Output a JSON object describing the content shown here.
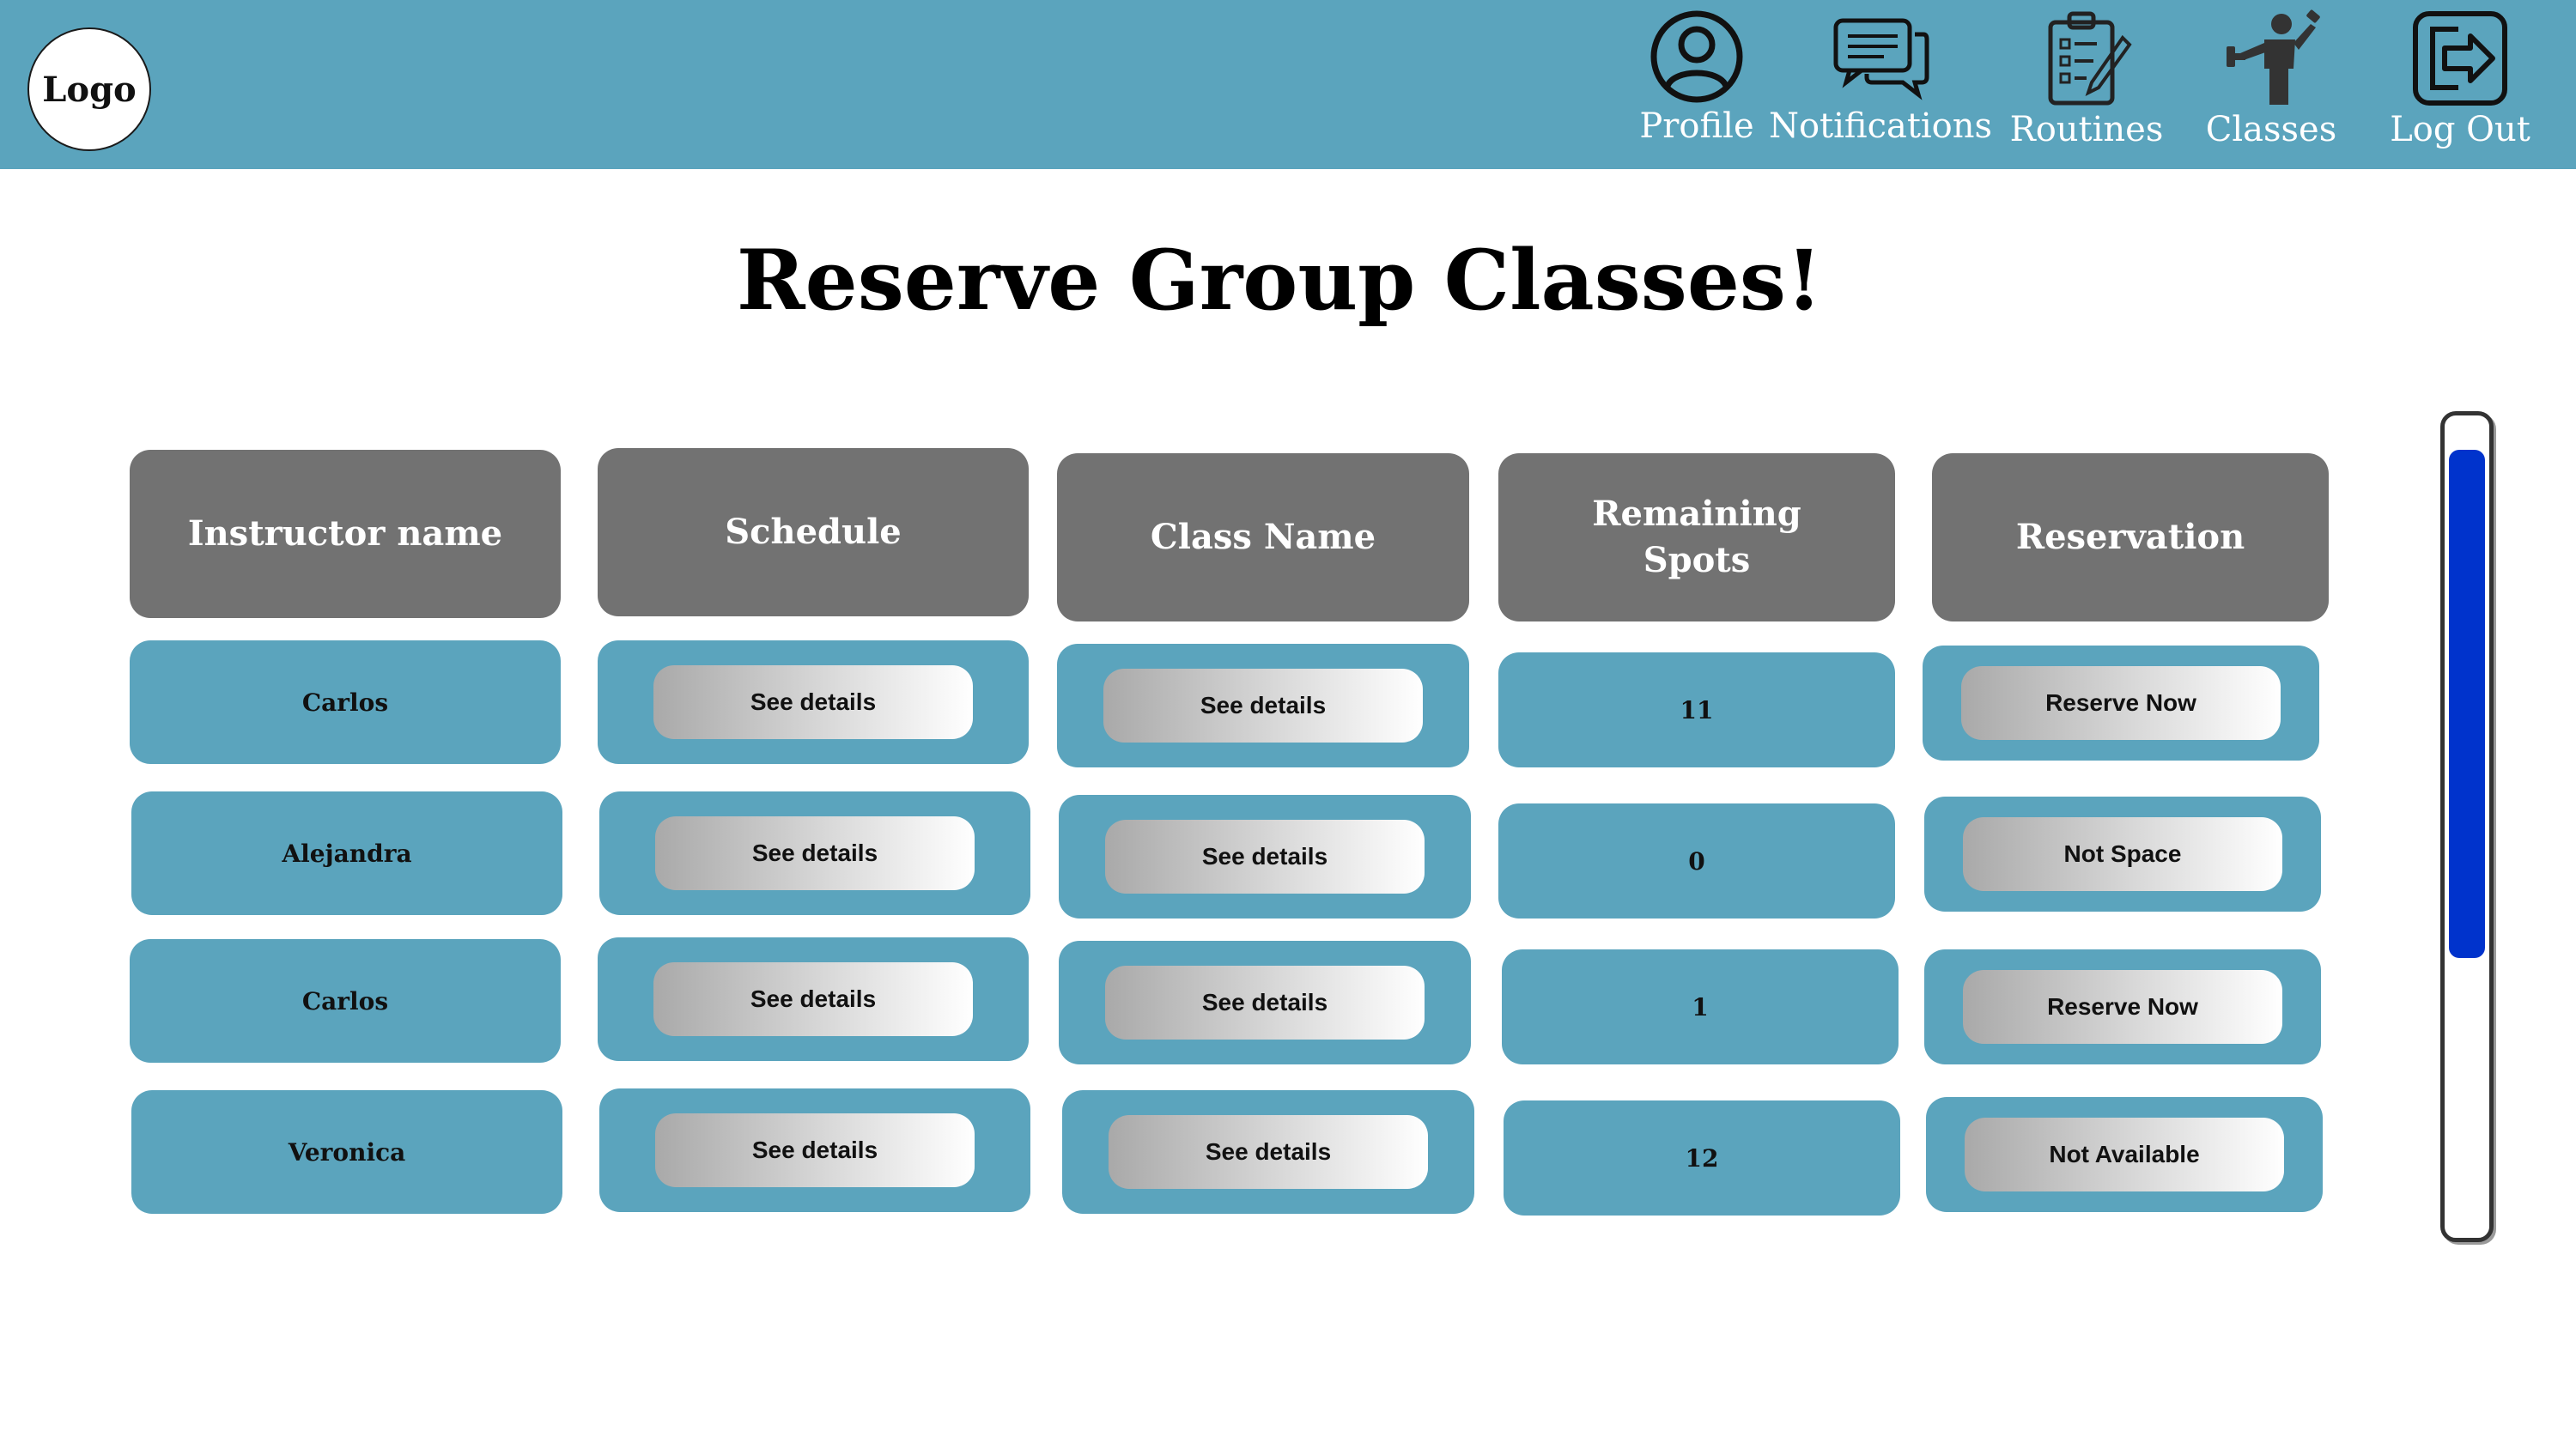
{
  "header": {
    "logo_text": "Logo",
    "nav": [
      {
        "label": "Profile",
        "icon": "profile-icon"
      },
      {
        "label": "Notifications",
        "icon": "notifications-icon"
      },
      {
        "label": "Routines",
        "icon": "routines-icon"
      },
      {
        "label": "Classes",
        "icon": "classes-icon"
      },
      {
        "label": "Log Out",
        "icon": "logout-icon"
      }
    ]
  },
  "page": {
    "title": "Reserve Group Classes!"
  },
  "table": {
    "headers": [
      "Instructor name",
      "Schedule",
      "Class Name",
      "Remaining Spots",
      "Reservation"
    ],
    "rows": [
      {
        "instructor": "Carlos",
        "schedule": "See details",
        "class_name": "See details",
        "spots": "11",
        "reservation": "Reserve Now"
      },
      {
        "instructor": "Alejandra",
        "schedule": "See details",
        "class_name": "See details",
        "spots": "0",
        "reservation": "Not Space"
      },
      {
        "instructor": "Carlos",
        "schedule": "See details",
        "class_name": "See details",
        "spots": "1",
        "reservation": "Reserve Now"
      },
      {
        "instructor": "Veronica",
        "schedule": "See details",
        "class_name": "See details",
        "spots": "12",
        "reservation": "Not Available"
      }
    ]
  },
  "scrollbar": {
    "position": 0.0
  },
  "colors": {
    "topbar": "#5ba4bd",
    "header_cell": "#727272",
    "row_cell": "#5ba4bd",
    "scroll_thumb": "#0033cc"
  }
}
